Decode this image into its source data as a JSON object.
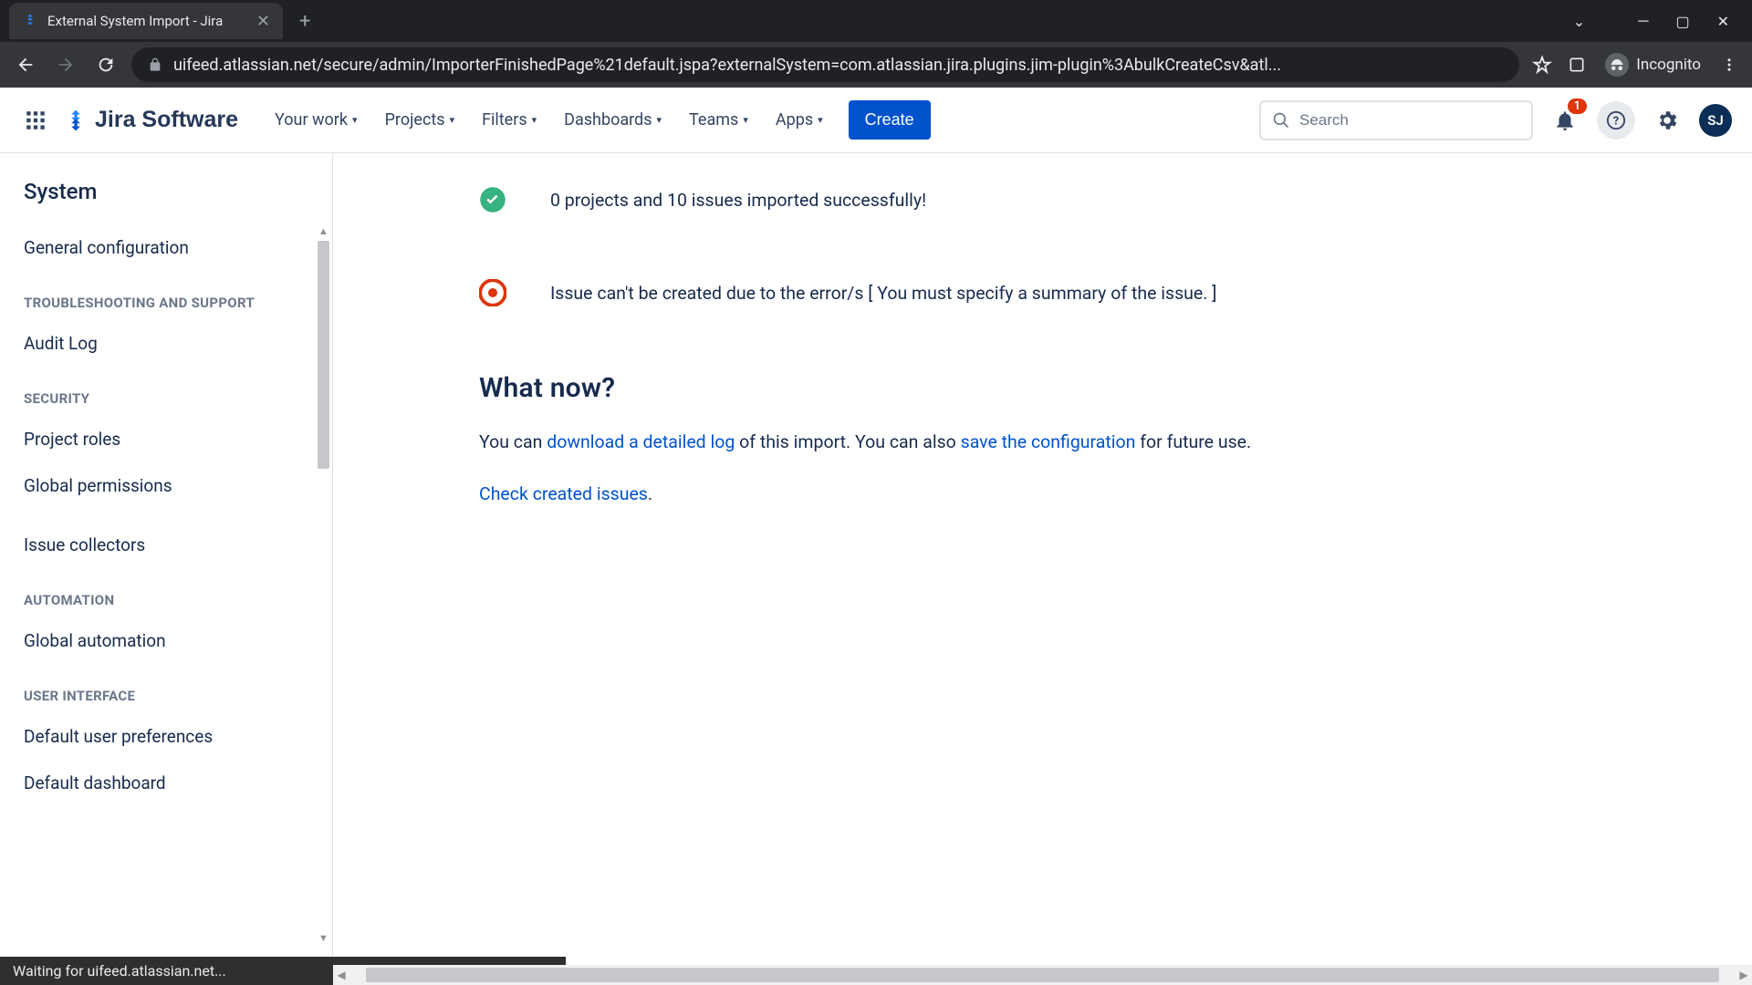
{
  "browser": {
    "tab_title": "External System Import - Jira",
    "url": "uifeed.atlassian.net/secure/admin/ImporterFinishedPage%21default.jspa?externalSystem=com.atlassian.jira.plugins.jim-plugin%3AbulkCreateCsv&atl...",
    "incognito_label": "Incognito",
    "status_text": "Waiting for uifeed.atlassian.net..."
  },
  "header": {
    "product": "Jira Software",
    "nav": {
      "your_work": "Your work",
      "projects": "Projects",
      "filters": "Filters",
      "dashboards": "Dashboards",
      "teams": "Teams",
      "apps": "Apps"
    },
    "create": "Create",
    "search_placeholder": "Search",
    "notification_count": "1",
    "avatar_initials": "SJ"
  },
  "sidebar": {
    "title": "System",
    "general_config": "General configuration",
    "sections": {
      "troubleshooting": {
        "heading": "TROUBLESHOOTING AND SUPPORT",
        "audit_log": "Audit Log"
      },
      "security": {
        "heading": "SECURITY",
        "project_roles": "Project roles",
        "global_permissions": "Global permissions",
        "issue_collectors": "Issue collectors"
      },
      "automation": {
        "heading": "AUTOMATION",
        "global_automation": "Global automation"
      },
      "ui": {
        "heading": "USER INTERFACE",
        "default_user_prefs": "Default user preferences",
        "default_dashboard": "Default dashboard"
      }
    }
  },
  "content": {
    "success_msg": "0 projects and 10 issues imported successfully!",
    "error_msg": "Issue can't be created due to the error/s [ You must specify a summary of the issue. ]",
    "what_now_heading": "What now?",
    "para_prefix": "You can ",
    "download_log_link": "download a detailed log",
    "para_mid": " of this import. You can also ",
    "save_config_link": "save the configuration",
    "para_suffix": " for future use.",
    "check_issues_link": "Check created issues",
    "period": "."
  }
}
